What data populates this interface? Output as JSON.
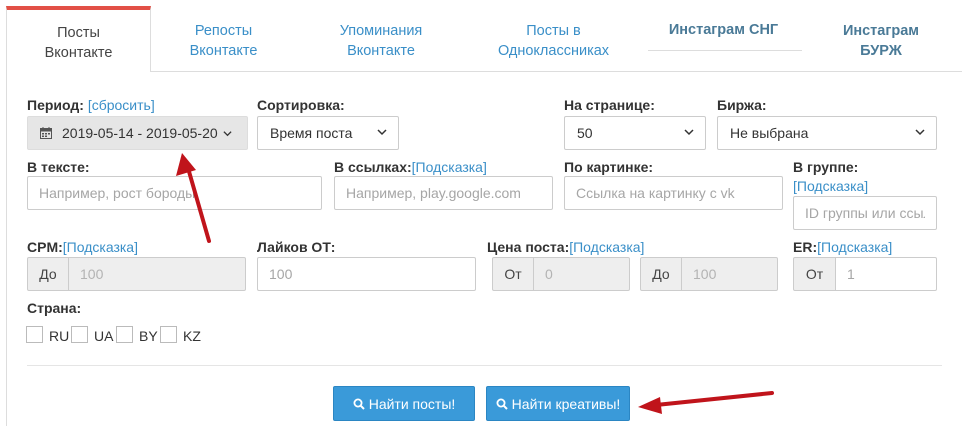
{
  "tabs": [
    {
      "line1": "Посты",
      "line2": "Вконтакте"
    },
    {
      "line1": "Репосты",
      "line2": "Вконтакте"
    },
    {
      "line1": "Упоминания",
      "line2": "Вконтакте"
    },
    {
      "line1": "Посты в",
      "line2": "Одноклассниках"
    },
    {
      "line1": "Инстаграм СНГ",
      "line2": ""
    },
    {
      "line1": "Инстаграм",
      "line2": "БУРЖ"
    }
  ],
  "filters": {
    "period": {
      "label": "Период:",
      "reset": "[сбросить]",
      "value": "2019-05-14 - 2019-05-20"
    },
    "sort": {
      "label": "Сортировка:",
      "value": "Время поста"
    },
    "per_page": {
      "label": "На странице:",
      "value": "50"
    },
    "exchange": {
      "label": "Биржа:",
      "value": "Не выбрана"
    },
    "in_text": {
      "label": "В тексте:",
      "placeholder": "Например, рост бороды"
    },
    "in_links": {
      "label": "В ссылках:",
      "hint": "[Подсказка]",
      "placeholder": "Например, play.google.com"
    },
    "by_image": {
      "label": "По картинке:",
      "placeholder": "Ссылка на картинку с vk"
    },
    "in_group": {
      "label": "В группе:",
      "hint": "[Подсказка]",
      "placeholder": "ID группы или ссылка"
    },
    "cpm": {
      "label": "CPM:",
      "hint": "[Подсказка]",
      "addon": "До",
      "placeholder": "100"
    },
    "likes_from": {
      "label": "Лайков ОТ:",
      "placeholder": "100"
    },
    "post_price": {
      "label": "Цена поста:",
      "hint": "[Подсказка]",
      "from_addon": "От",
      "from_placeholder": "0",
      "to_addon": "До",
      "to_placeholder": "100"
    },
    "er": {
      "label": "ER:",
      "hint": "[Подсказка]",
      "addon": "От",
      "placeholder": "1"
    },
    "country": {
      "label": "Страна:",
      "options": [
        "RU",
        "UA",
        "BY",
        "KZ"
      ]
    }
  },
  "buttons": {
    "find_posts": "Найти посты!",
    "find_creatives": "Найти креативы!"
  },
  "colors": {
    "accent": "#3a9ad9",
    "link": "#3a8fc8",
    "active_tab_border": "#e25046",
    "annotation_arrow": "#c0141b"
  }
}
